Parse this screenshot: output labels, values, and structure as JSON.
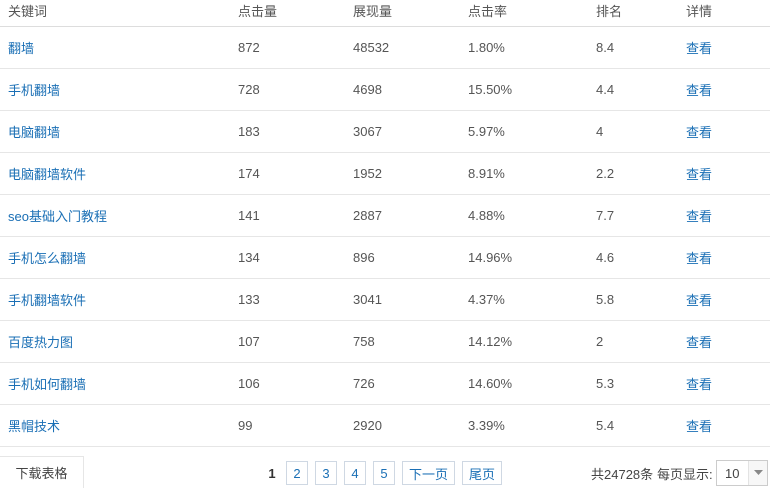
{
  "table": {
    "headers": {
      "keyword": "关键词",
      "clicks": "点击量",
      "impressions": "展现量",
      "ctr": "点击率",
      "rank": "排名",
      "detail": "详情"
    },
    "rows": [
      {
        "keyword": "翻墙",
        "clicks": "872",
        "impressions": "48532",
        "ctr": "1.80%",
        "rank": "8.4",
        "detail": "查看"
      },
      {
        "keyword": "手机翻墙",
        "clicks": "728",
        "impressions": "4698",
        "ctr": "15.50%",
        "rank": "4.4",
        "detail": "查看"
      },
      {
        "keyword": "电脑翻墙",
        "clicks": "183",
        "impressions": "3067",
        "ctr": "5.97%",
        "rank": "4",
        "detail": "查看"
      },
      {
        "keyword": "电脑翻墙软件",
        "clicks": "174",
        "impressions": "1952",
        "ctr": "8.91%",
        "rank": "2.2",
        "detail": "查看"
      },
      {
        "keyword": "seo基础入门教程",
        "clicks": "141",
        "impressions": "2887",
        "ctr": "4.88%",
        "rank": "7.7",
        "detail": "查看"
      },
      {
        "keyword": "手机怎么翻墙",
        "clicks": "134",
        "impressions": "896",
        "ctr": "14.96%",
        "rank": "4.6",
        "detail": "查看"
      },
      {
        "keyword": "手机翻墙软件",
        "clicks": "133",
        "impressions": "3041",
        "ctr": "4.37%",
        "rank": "5.8",
        "detail": "查看"
      },
      {
        "keyword": "百度热力图",
        "clicks": "107",
        "impressions": "758",
        "ctr": "14.12%",
        "rank": "2",
        "detail": "查看"
      },
      {
        "keyword": "手机如何翻墙",
        "clicks": "106",
        "impressions": "726",
        "ctr": "14.60%",
        "rank": "5.3",
        "detail": "查看"
      },
      {
        "keyword": "黑帽技术",
        "clicks": "99",
        "impressions": "2920",
        "ctr": "3.39%",
        "rank": "5.4",
        "detail": "查看"
      }
    ]
  },
  "footer": {
    "download_label": "下载表格",
    "pagination": {
      "current": "1",
      "pages": [
        "2",
        "3",
        "4",
        "5"
      ],
      "next_label": "下一页",
      "last_label": "尾页"
    },
    "total_label": "共24728条",
    "per_page_label": "每页显示:",
    "per_page_value": "10"
  },
  "icons": {
    "select_arrow": "chevron-down-icon"
  },
  "colors": {
    "link": "#1a6fb5",
    "text": "#555555",
    "row_border": "#e6e6e6",
    "pager_border": "#cfd8e3"
  }
}
